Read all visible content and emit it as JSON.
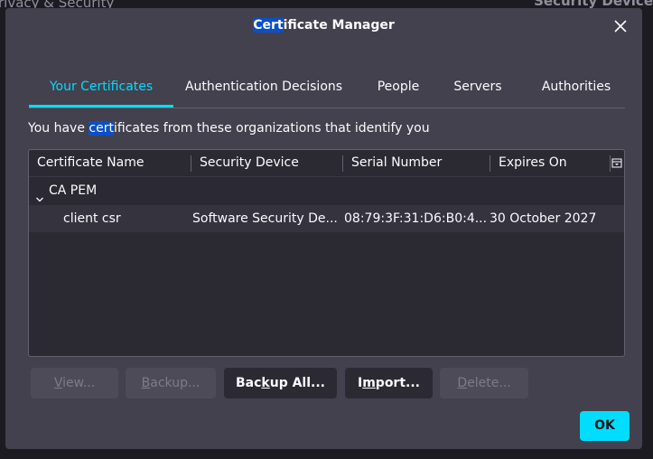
{
  "background": {
    "left_fragment": "rivacy & Security",
    "right_fragment": "Security Device"
  },
  "dialog": {
    "title_highlight": "Cert",
    "title_rest": "ificate Manager",
    "close_icon": "close-icon"
  },
  "tabs": [
    {
      "label": "Your Certificates",
      "selected": true
    },
    {
      "label": "Authentication Decisions",
      "selected": false
    },
    {
      "label": "People",
      "selected": false
    },
    {
      "label": "Servers",
      "selected": false
    },
    {
      "label": "Authorities",
      "selected": false
    }
  ],
  "description": {
    "before": "You have ",
    "highlight": "cert",
    "after": "ificates from these organizations that identify you"
  },
  "table": {
    "columns": [
      "Certificate Name",
      "Security Device",
      "Serial Number",
      "Expires On"
    ],
    "groups": [
      {
        "name": "CA PEM",
        "expanded": true,
        "rows": [
          {
            "name": "client csr",
            "device": "Software Security De...",
            "serial": "08:79:3F:31:D6:B0:4...",
            "expires": "30 October 2027"
          }
        ]
      }
    ]
  },
  "buttons": {
    "view": {
      "label_u": "V",
      "label_rest": "iew...",
      "enabled": false
    },
    "backup": {
      "label_u": "B",
      "label_rest": "ackup...",
      "enabled": false
    },
    "backup_all": {
      "label_pre": "Bac",
      "label_u": "k",
      "label_rest": "up All...",
      "enabled": true
    },
    "import": {
      "label_pre": "I",
      "label_u": "m",
      "label_rest": "port...",
      "enabled": true
    },
    "delete": {
      "label_u": "D",
      "label_rest": "elete...",
      "enabled": false
    },
    "ok": "OK"
  },
  "colors": {
    "accent": "#00ddff",
    "dialog_bg": "#42414d",
    "selection_highlight": "#0a50c7"
  }
}
